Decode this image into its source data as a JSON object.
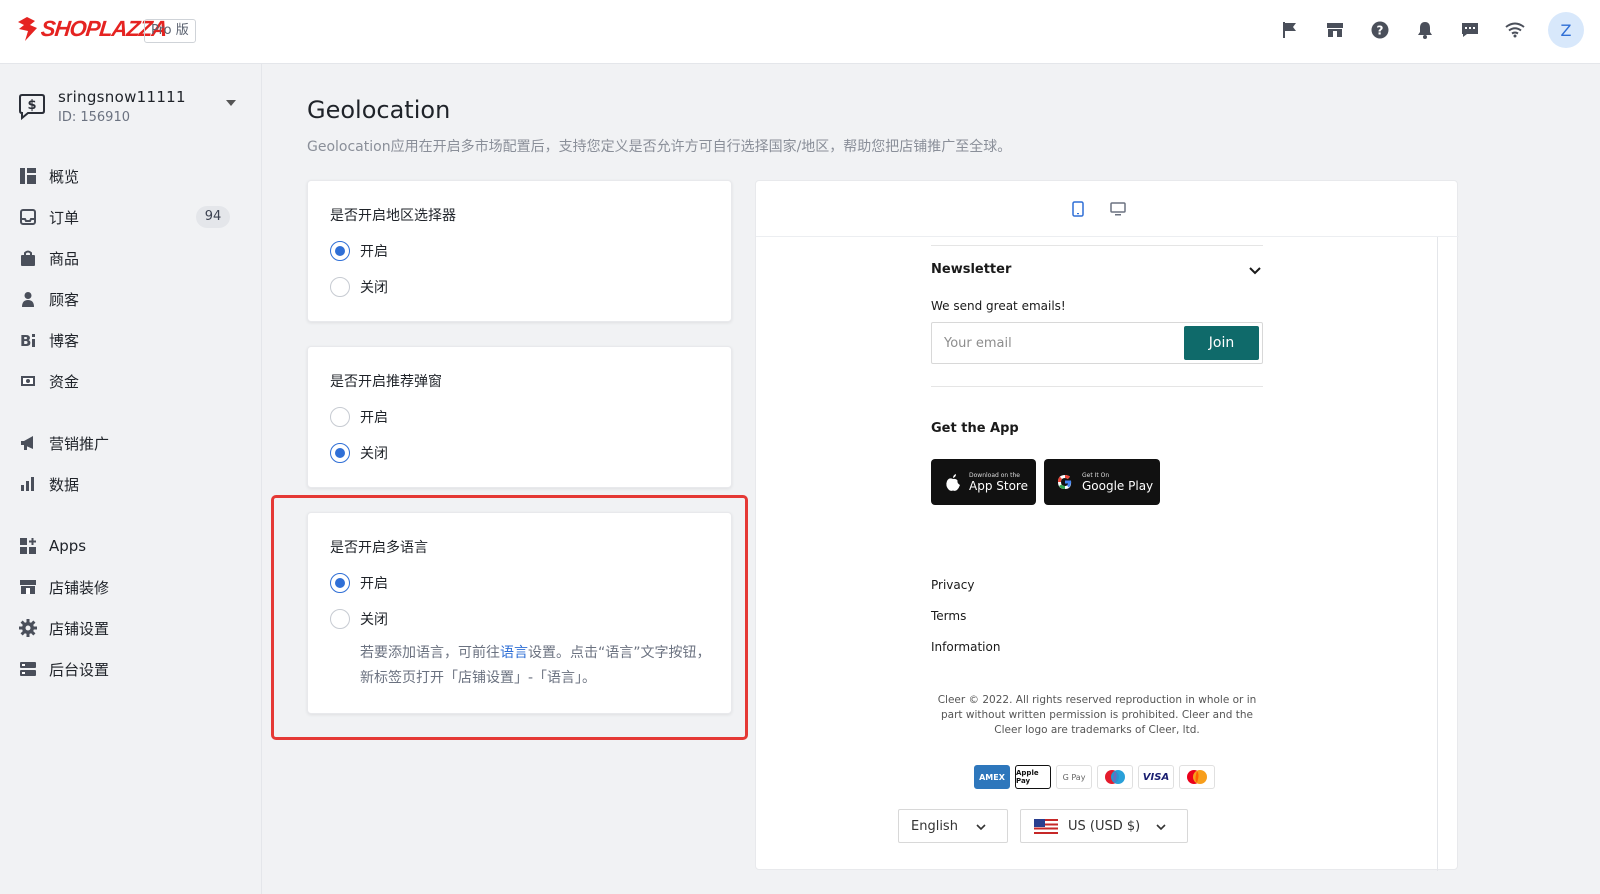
{
  "topbar": {
    "logo_text": "SHOPLAZZA",
    "plan_badge": "Pro 版",
    "icons": [
      "flag-icon",
      "store-icon",
      "help-icon",
      "bell-icon",
      "message-icon",
      "wifi-icon"
    ],
    "avatar_letter": "Z"
  },
  "store": {
    "name": "sringsnow11111",
    "id": "ID: 156910"
  },
  "sidebar": {
    "items": [
      {
        "label": "概览",
        "icon": "overview-icon"
      },
      {
        "label": "订单",
        "icon": "orders-icon",
        "count": "94"
      },
      {
        "label": "商品",
        "icon": "products-icon"
      },
      {
        "label": "顾客",
        "icon": "customers-icon"
      },
      {
        "label": "博客",
        "icon": "blog-icon"
      },
      {
        "label": "资金",
        "icon": "finance-icon"
      },
      {
        "label": "营销推广",
        "icon": "marketing-icon"
      },
      {
        "label": "数据",
        "icon": "analytics-icon"
      },
      {
        "label": "Apps",
        "icon": "apps-icon"
      },
      {
        "label": "店铺装修",
        "icon": "theme-icon"
      },
      {
        "label": "店铺设置",
        "icon": "settings-icon"
      },
      {
        "label": "后台设置",
        "icon": "admin-settings-icon"
      }
    ]
  },
  "page": {
    "title": "Geolocation",
    "description": "Geolocation应用在开启多市场配置后，支持您定义是否允许方可自行选择国家/地区，帮助您把店铺推广至全球。"
  },
  "cards": [
    {
      "title": "是否开启地区选择器",
      "options": [
        "开启",
        "关闭"
      ],
      "selected": "开启"
    },
    {
      "title": "是否开启推荐弹窗",
      "options": [
        "开启",
        "关闭"
      ],
      "selected": "关闭"
    },
    {
      "title": "是否开启多语言",
      "options": [
        "开启",
        "关闭"
      ],
      "selected": "开启",
      "hint_before": "若要添加语言，可前往",
      "hint_link": "语言",
      "hint_after": "设置。点击“语言”文字按钮，新标签页打开「店铺设置」-「语言」。"
    }
  ],
  "preview": {
    "newsletter_title": "Newsletter",
    "newsletter_sub": "We send great emails!",
    "email_placeholder": "Your email",
    "join_label": "Join",
    "app_title": "Get the App",
    "app_store_small": "Download on the",
    "app_store_big": "App Store",
    "google_small": "Get It On",
    "google_big": "Google Play",
    "links": [
      "Privacy",
      "Terms",
      "Information"
    ],
    "copyright": "Cleer © 2022. All rights reserved reproduction in whole or in part without written permission is prohibited. Cleer and the Cleer logo are trademarks of Cleer, ltd.",
    "payments": [
      "AMEX",
      "Apple Pay",
      "G Pay",
      "Maestro",
      "VISA",
      "Mastercard"
    ],
    "language": "English",
    "currency": "US (USD $)"
  },
  "colors": {
    "brand": "#e52321",
    "accent": "#2f6fd6",
    "join": "#0f6a6a",
    "highlight": "#e53935"
  }
}
